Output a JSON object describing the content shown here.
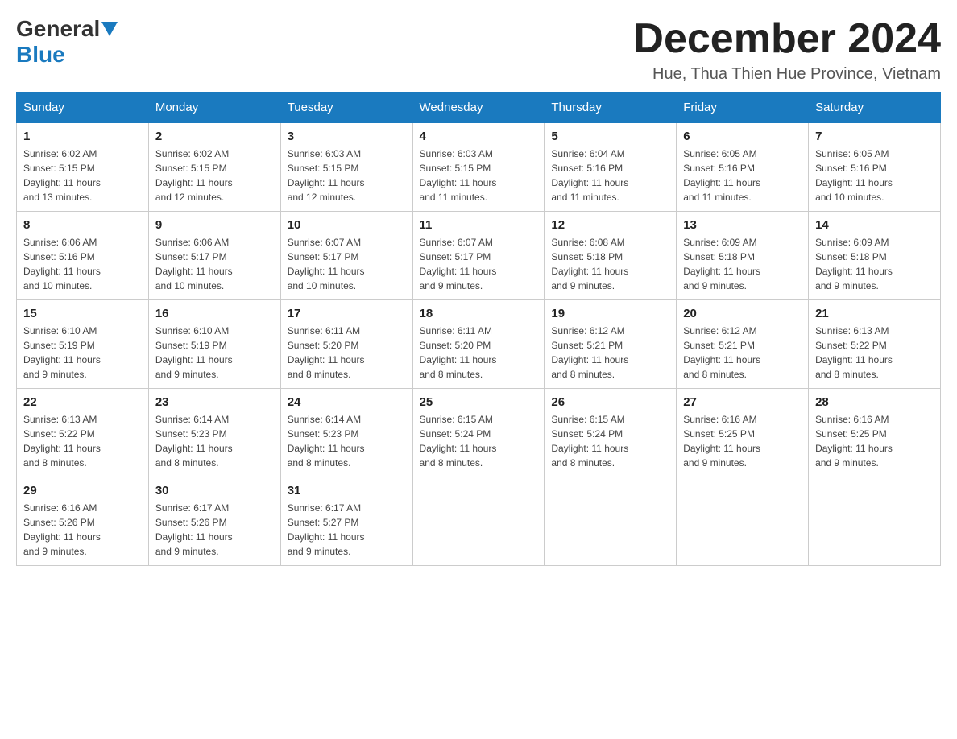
{
  "header": {
    "logo": {
      "general": "General",
      "blue": "Blue"
    },
    "month_year": "December 2024",
    "location": "Hue, Thua Thien Hue Province, Vietnam"
  },
  "days_of_week": [
    "Sunday",
    "Monday",
    "Tuesday",
    "Wednesday",
    "Thursday",
    "Friday",
    "Saturday"
  ],
  "weeks": [
    [
      {
        "day": "1",
        "sunrise": "6:02 AM",
        "sunset": "5:15 PM",
        "daylight": "11 hours and 13 minutes."
      },
      {
        "day": "2",
        "sunrise": "6:02 AM",
        "sunset": "5:15 PM",
        "daylight": "11 hours and 12 minutes."
      },
      {
        "day": "3",
        "sunrise": "6:03 AM",
        "sunset": "5:15 PM",
        "daylight": "11 hours and 12 minutes."
      },
      {
        "day": "4",
        "sunrise": "6:03 AM",
        "sunset": "5:15 PM",
        "daylight": "11 hours and 11 minutes."
      },
      {
        "day": "5",
        "sunrise": "6:04 AM",
        "sunset": "5:16 PM",
        "daylight": "11 hours and 11 minutes."
      },
      {
        "day": "6",
        "sunrise": "6:05 AM",
        "sunset": "5:16 PM",
        "daylight": "11 hours and 11 minutes."
      },
      {
        "day": "7",
        "sunrise": "6:05 AM",
        "sunset": "5:16 PM",
        "daylight": "11 hours and 10 minutes."
      }
    ],
    [
      {
        "day": "8",
        "sunrise": "6:06 AM",
        "sunset": "5:16 PM",
        "daylight": "11 hours and 10 minutes."
      },
      {
        "day": "9",
        "sunrise": "6:06 AM",
        "sunset": "5:17 PM",
        "daylight": "11 hours and 10 minutes."
      },
      {
        "day": "10",
        "sunrise": "6:07 AM",
        "sunset": "5:17 PM",
        "daylight": "11 hours and 10 minutes."
      },
      {
        "day": "11",
        "sunrise": "6:07 AM",
        "sunset": "5:17 PM",
        "daylight": "11 hours and 9 minutes."
      },
      {
        "day": "12",
        "sunrise": "6:08 AM",
        "sunset": "5:18 PM",
        "daylight": "11 hours and 9 minutes."
      },
      {
        "day": "13",
        "sunrise": "6:09 AM",
        "sunset": "5:18 PM",
        "daylight": "11 hours and 9 minutes."
      },
      {
        "day": "14",
        "sunrise": "6:09 AM",
        "sunset": "5:18 PM",
        "daylight": "11 hours and 9 minutes."
      }
    ],
    [
      {
        "day": "15",
        "sunrise": "6:10 AM",
        "sunset": "5:19 PM",
        "daylight": "11 hours and 9 minutes."
      },
      {
        "day": "16",
        "sunrise": "6:10 AM",
        "sunset": "5:19 PM",
        "daylight": "11 hours and 9 minutes."
      },
      {
        "day": "17",
        "sunrise": "6:11 AM",
        "sunset": "5:20 PM",
        "daylight": "11 hours and 8 minutes."
      },
      {
        "day": "18",
        "sunrise": "6:11 AM",
        "sunset": "5:20 PM",
        "daylight": "11 hours and 8 minutes."
      },
      {
        "day": "19",
        "sunrise": "6:12 AM",
        "sunset": "5:21 PM",
        "daylight": "11 hours and 8 minutes."
      },
      {
        "day": "20",
        "sunrise": "6:12 AM",
        "sunset": "5:21 PM",
        "daylight": "11 hours and 8 minutes."
      },
      {
        "day": "21",
        "sunrise": "6:13 AM",
        "sunset": "5:22 PM",
        "daylight": "11 hours and 8 minutes."
      }
    ],
    [
      {
        "day": "22",
        "sunrise": "6:13 AM",
        "sunset": "5:22 PM",
        "daylight": "11 hours and 8 minutes."
      },
      {
        "day": "23",
        "sunrise": "6:14 AM",
        "sunset": "5:23 PM",
        "daylight": "11 hours and 8 minutes."
      },
      {
        "day": "24",
        "sunrise": "6:14 AM",
        "sunset": "5:23 PM",
        "daylight": "11 hours and 8 minutes."
      },
      {
        "day": "25",
        "sunrise": "6:15 AM",
        "sunset": "5:24 PM",
        "daylight": "11 hours and 8 minutes."
      },
      {
        "day": "26",
        "sunrise": "6:15 AM",
        "sunset": "5:24 PM",
        "daylight": "11 hours and 8 minutes."
      },
      {
        "day": "27",
        "sunrise": "6:16 AM",
        "sunset": "5:25 PM",
        "daylight": "11 hours and 9 minutes."
      },
      {
        "day": "28",
        "sunrise": "6:16 AM",
        "sunset": "5:25 PM",
        "daylight": "11 hours and 9 minutes."
      }
    ],
    [
      {
        "day": "29",
        "sunrise": "6:16 AM",
        "sunset": "5:26 PM",
        "daylight": "11 hours and 9 minutes."
      },
      {
        "day": "30",
        "sunrise": "6:17 AM",
        "sunset": "5:26 PM",
        "daylight": "11 hours and 9 minutes."
      },
      {
        "day": "31",
        "sunrise": "6:17 AM",
        "sunset": "5:27 PM",
        "daylight": "11 hours and 9 minutes."
      },
      null,
      null,
      null,
      null
    ]
  ],
  "labels": {
    "sunrise": "Sunrise:",
    "sunset": "Sunset:",
    "daylight": "Daylight:"
  }
}
